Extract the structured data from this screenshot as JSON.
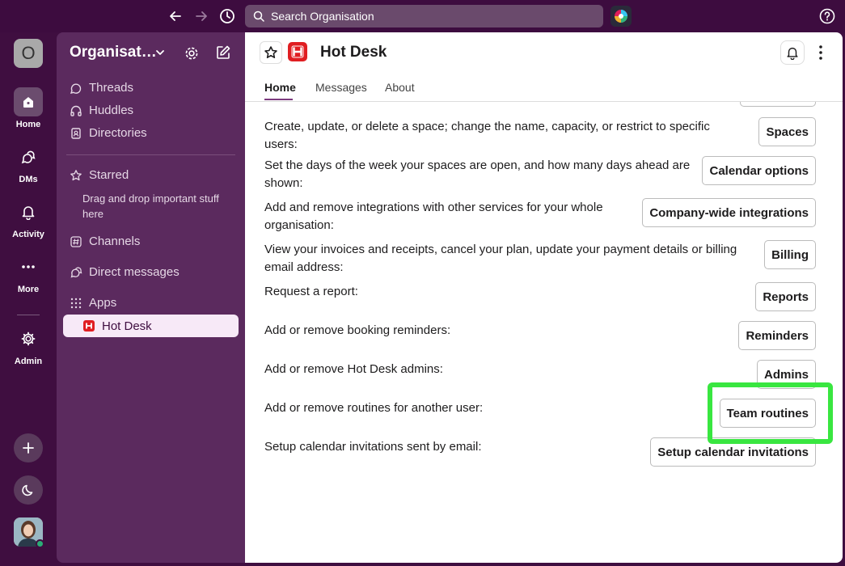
{
  "topbar": {
    "search_placeholder": "Search Organisation"
  },
  "rail": {
    "workspace_initial": "O",
    "items": [
      {
        "label": "Home",
        "icon": "home-icon"
      },
      {
        "label": "DMs",
        "icon": "dms-icon"
      },
      {
        "label": "Activity",
        "icon": "bell-icon"
      },
      {
        "label": "More",
        "icon": "more-icon"
      },
      {
        "label": "Admin",
        "icon": "gear-icon"
      }
    ]
  },
  "sidebar": {
    "org_name": "Organisation",
    "items": [
      {
        "label": "Threads"
      },
      {
        "label": "Huddles"
      },
      {
        "label": "Directories"
      }
    ],
    "starred_label": "Starred",
    "starred_hint": "Drag and drop important stuff here",
    "channels_label": "Channels",
    "dms_label": "Direct messages",
    "apps_label": "Apps",
    "active_app": "Hot Desk"
  },
  "main": {
    "title": "Hot Desk",
    "tabs": [
      "Home",
      "Messages",
      "About"
    ],
    "rows": [
      {
        "text": "Create, update, or delete a space; change the name, capacity, or restrict to specific users:",
        "button": "Spaces"
      },
      {
        "text": "Set the days of the week your spaces are open, and how many days ahead are shown:",
        "button": "Calendar options"
      },
      {
        "text": "Add and remove integrations with other services for your whole organisation:",
        "button": "Company-wide integrations"
      },
      {
        "text": "View your invoices and receipts, cancel your plan, update your payment details or billing email address:",
        "button": "Billing"
      },
      {
        "text": "Request a report:",
        "button": "Reports"
      },
      {
        "text": "Add or remove booking reminders:",
        "button": "Reminders"
      },
      {
        "text": "Add or remove Hot Desk admins:",
        "button": "Admins"
      },
      {
        "text": "Add or remove routines for another user:",
        "button": "Team routines"
      },
      {
        "text": "Setup calendar invitations sent by email:",
        "button": "Setup calendar invitations"
      }
    ]
  },
  "colors": {
    "aubergine": "#3f0e40",
    "sidebar": "#5b2a5e",
    "hotdesk_red": "#e01e22",
    "highlight_green": "#39e640"
  }
}
